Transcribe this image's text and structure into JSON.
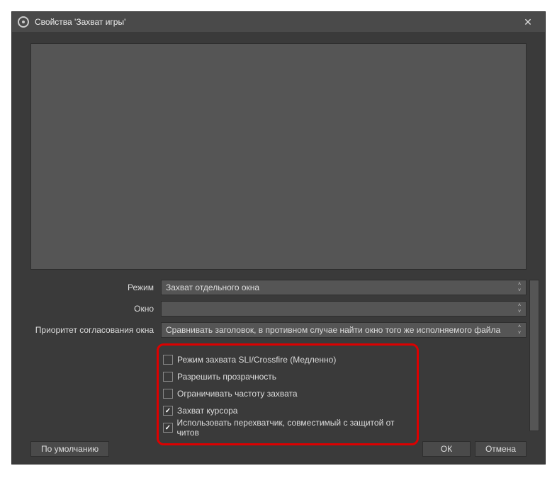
{
  "titlebar": {
    "title": "Свойства 'Захват игры'"
  },
  "form": {
    "mode": {
      "label": "Режим",
      "value": "Захват отдельного окна"
    },
    "window": {
      "label": "Окно",
      "value": ""
    },
    "priority": {
      "label": "Приоритет согласования окна",
      "value": "Сравнивать заголовок, в противном случае найти окно того же исполняемого файла"
    }
  },
  "checks": {
    "sli": {
      "label": "Режим захвата SLI/Crossfire (Медленно)",
      "checked": false
    },
    "transparency": {
      "label": "Разрешить прозрачность",
      "checked": false
    },
    "limitfps": {
      "label": "Ограничивать частоту захвата",
      "checked": false
    },
    "cursor": {
      "label": "Захват курсора",
      "checked": true
    },
    "anticheat": {
      "label": "Использовать перехватчик, совместимый с защитой от читов",
      "checked": true
    }
  },
  "footer": {
    "defaults": "По умолчанию",
    "ok": "ОК",
    "cancel": "Отмена"
  }
}
